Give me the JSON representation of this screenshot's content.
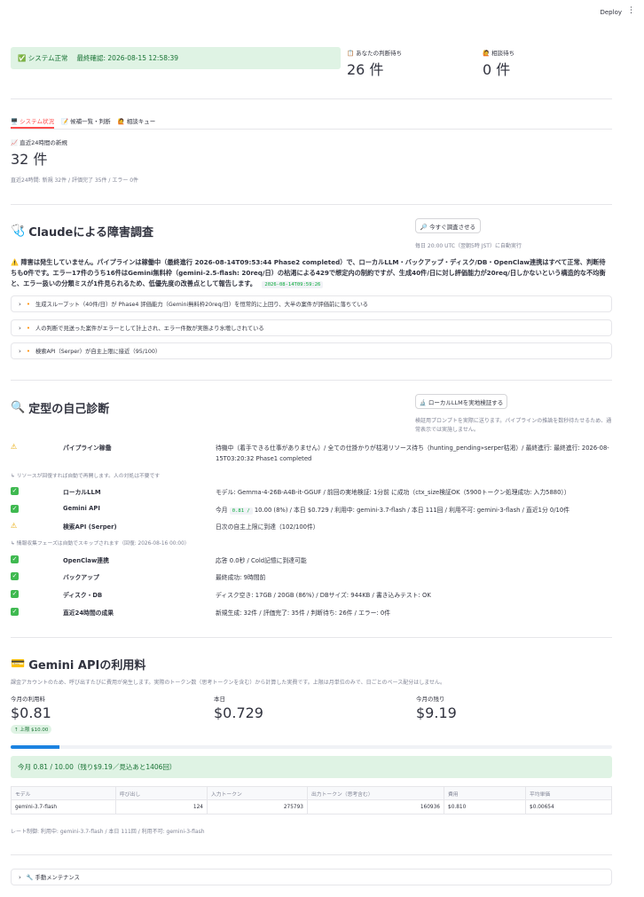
{
  "header": {
    "deploy_label": "Deploy",
    "menu_glyph": "⋮"
  },
  "status": {
    "message": "✅ システム正常",
    "last_check": "最終確認: 2026-08-15 12:58:39",
    "pending_label": "📋 あなたの判断待ち",
    "pending_value": "26 件",
    "consult_label": "🙋 相談待ち",
    "consult_value": "0 件"
  },
  "tabs": [
    {
      "label": "🖥️ システム状況",
      "active": true
    },
    {
      "label": "📝 候補一覧・判断",
      "active": false
    },
    {
      "label": "🙋 相談キュー",
      "active": false
    }
  ],
  "recent": {
    "label": "📈 直近24時間の新規",
    "value": "32 件",
    "caption": "直近24時間: 新規 32件 / 評価完了 35件 / エラー 0件"
  },
  "investigation": {
    "icon": "🩺",
    "title": "Claudeによる障害調査",
    "button": "🔎 今すぐ調査させる",
    "schedule": "毎日 20:00 UTC（翌朝5時 JST）に自動実行",
    "summary": "⚠️ 障害は発生していません。パイプラインは稼働中（最終進行 2026-08-14T09:53:44 Phase2 completed）で、ローカルLLM・バックアップ・ディスク/DB・OpenClaw連携はすべて正常、判断待ちも0件です。エラー17件のうち16件はGemini無料枠（gemini-2.5-flash: 20req/日）の枯渇による429で想定内の制約ですが、生成40件/日に対し評価能力が20req/日しかないという構造的な不均衡と、エラー扱いの分類ミスが1件見られるため、低優先度の改善点として報告します。",
    "timestamp": "2026-08-14T09:59:26",
    "findings": [
      "生成スループット（40件/日）が Phase4 評価能力（Gemini無料枠20req/日）を恒常的に上回り、大半の案件が評価前に落ちている",
      "人の判断で見送った案件がエラーとして計上され、エラー件数が実態より水増しされている",
      "検索API（Serper）が自主上限に接近（95/100）"
    ]
  },
  "diagnosis": {
    "icon": "🔍",
    "title": "定型の自己診断",
    "button": "🔬 ローカルLLMを実地検証する",
    "caption": "検証用プロンプトを実際に送ります。パイプラインの推論を数秒待たせるため、通常表示では実施しません。",
    "rows": [
      {
        "status": "warn",
        "name": "パイプライン稼働",
        "value": "待機中（着手できる仕事がありません）/ 全ての仕掛かりが枯渇リソース待ち（hunting_pending»serper枯渇）/ 最終進行: 最終進行: 2026-08-15T03:20:32 Phase1 completed"
      },
      {
        "status": "ok",
        "name": "ローカルLLM",
        "value": "モデル: Gemma-4-26B-A4B-it-GGUF / 前回の実地検証: 1分前 に成功（ctx_size検証OK（5900トークン処理成功: 入力5880））"
      },
      {
        "status": "ok",
        "name": "Gemini API",
        "value_prefix": "今月",
        "value_code": "0.81 /",
        "value_suffix": "10.00 (8%) / 本日 $0.729 / 利用中: gemini-3.7-flash / 本日 111回 / 利用不可: gemini-3-flash / 直近1分 0/10件"
      },
      {
        "status": "warn",
        "name": "検索API (Serper)",
        "value": "日次の自主上限に到達（102/100件）"
      },
      {
        "status": "ok",
        "name": "OpenClaw連携",
        "value": "応答 0.0秒 / Cold記憶に到達可能"
      },
      {
        "status": "ok",
        "name": "バックアップ",
        "value": "最終成功: 9時間前"
      },
      {
        "status": "ok",
        "name": "ディスク・DB",
        "value": "ディスク空き: 17GB / 20GB (86%) / DBサイズ: 944KB / 書き込みテスト: OK"
      },
      {
        "status": "ok",
        "name": "直近24時間の成果",
        "value": "新規生成: 32件 / 評価完了: 35件 / 判断待ち: 26件 / エラー: 0件"
      }
    ],
    "note1": "↳ リソースが回復すれば自動で再開します。人の対処は不要です",
    "note2": "↳ 情報収集フェーズは自動でスキップされます（回復: 2026-08-16 00:00）"
  },
  "gemini": {
    "icon": "💳",
    "title": "Gemini APIの利用料",
    "caption": "課金アカウントのため、呼び出すたびに費用が発生します。実際のトークン数（思考トークンを含む）から計算した実費です。上限は月単位のみで、日ごとのペース配分はしません。",
    "month_label": "今月の利用料",
    "month_value": "$0.81",
    "month_delta": "↑ 上限 $10.00",
    "today_label": "本日",
    "today_value": "$0.729",
    "remain_label": "今月の残り",
    "remain_value": "$9.19",
    "progress": 0.081,
    "info": "今月 0.81 / 10.00（残り$9.19／見込あと1406回）",
    "table_headers": [
      "モデル",
      "呼び出し",
      "入力トークン",
      "出力トークン（思考含む）",
      "費用",
      "平均単価"
    ],
    "table_rows": [
      [
        "gemini-3.7-flash",
        "124",
        "275793",
        "160936",
        "$0.810",
        "$0.00654"
      ]
    ],
    "rate_caption": "レート制御: 利用中: gemini-3.7-flash / 本日 111回 / 利用不可: gemini-3-flash"
  },
  "maintenance": {
    "label": "🔧 手動メンテナンス"
  }
}
